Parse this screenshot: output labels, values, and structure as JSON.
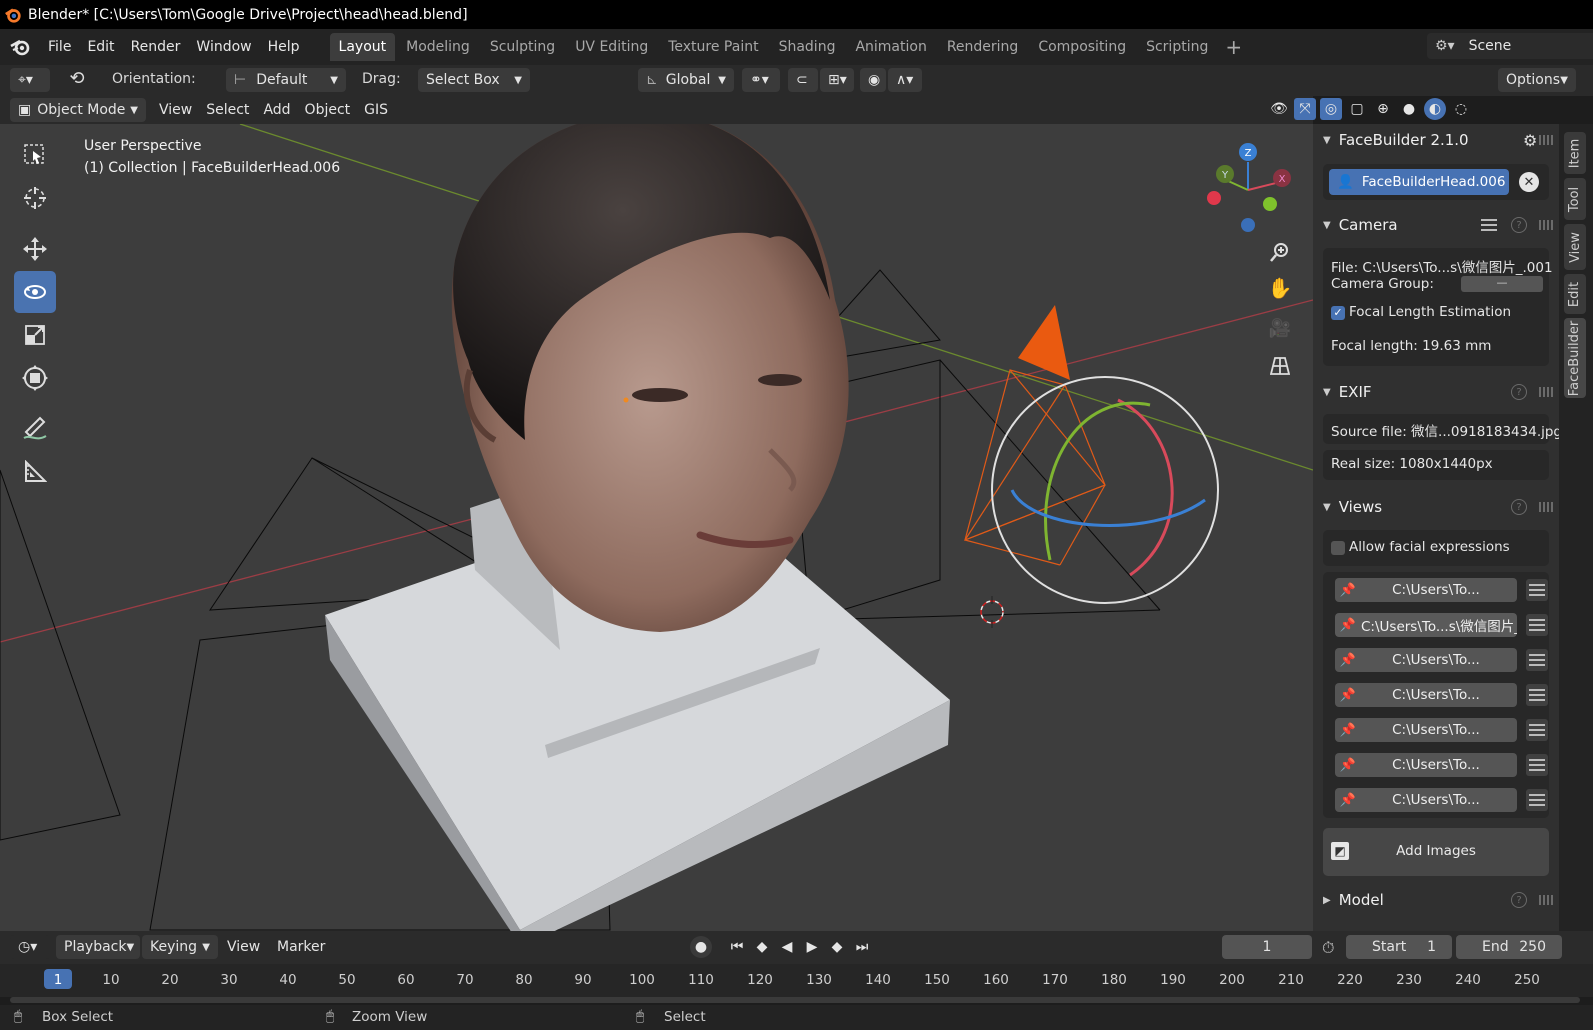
{
  "window": {
    "title": "Blender* [C:\\Users\\Tom\\Google Drive\\Project\\head\\head.blend]"
  },
  "menu": [
    "File",
    "Edit",
    "Render",
    "Window",
    "Help"
  ],
  "workspaces": [
    "Layout",
    "Modeling",
    "Sculpting",
    "UV Editing",
    "Texture Paint",
    "Shading",
    "Animation",
    "Rendering",
    "Compositing",
    "Scripting"
  ],
  "scene": "Scene",
  "toolheader": {
    "orientation_label": "Orientation:",
    "orientation_value": "Default",
    "drag_label": "Drag:",
    "drag_value": "Select Box",
    "transform_orientation": "Global",
    "options": "Options"
  },
  "modeheader": {
    "mode": "Object Mode",
    "items": [
      "View",
      "Select",
      "Add",
      "Object",
      "GIS"
    ]
  },
  "viewport": {
    "perspective": "User Perspective",
    "collection": "(1) Collection | FaceBuilderHead.006",
    "gizmo_axes": [
      "Z",
      "Y",
      "X"
    ]
  },
  "sidebar": {
    "addon_title": "FaceBuilder 2.1.0",
    "head_name": "FaceBuilderHead.006",
    "camera": {
      "title": "Camera",
      "file": "File: C:\\Users\\To...s\\微信图片_.001",
      "group_label": "Camera Group:",
      "group_value": "—",
      "focal_est_label": "Focal Length Estimation",
      "focal_est_checked": true,
      "focal_length": "Focal length: 19.63 mm"
    },
    "exif": {
      "title": "EXIF",
      "source": "Source file: 微信...0918183434.jpg",
      "real_size": "Real size: 1080x1440px"
    },
    "views": {
      "title": "Views",
      "allow_expr": "Allow facial expressions",
      "allow_expr_checked": false,
      "items": [
        "C:\\Users\\To...",
        "C:\\Users\\To...s\\微信图片_",
        "C:\\Users\\To...",
        "C:\\Users\\To...",
        "C:\\Users\\To...",
        "C:\\Users\\To...",
        "C:\\Users\\To..."
      ],
      "add_images": "Add Images"
    },
    "model": {
      "title": "Model"
    },
    "tabs": [
      "Item",
      "Tool",
      "View",
      "Edit",
      "FaceBuilder"
    ]
  },
  "timeline": {
    "menu": [
      "Playback",
      "Keying",
      "View",
      "Marker"
    ],
    "current_frame": "1",
    "start_label": "Start",
    "start": "1",
    "end_label": "End",
    "end": "250",
    "ticks": [
      "10",
      "20",
      "30",
      "40",
      "50",
      "60",
      "70",
      "80",
      "90",
      "100",
      "110",
      "120",
      "130",
      "140",
      "150",
      "160",
      "170",
      "180",
      "190",
      "200",
      "210",
      "220",
      "230",
      "240",
      "250"
    ],
    "cursor_frame": "1"
  },
  "status": {
    "left": "Box Select",
    "middle": "Zoom View",
    "right": "Select"
  },
  "colors": {
    "accent": "#4772b3",
    "bg": "#3d3d3d",
    "x_axis": "#d84a5b",
    "y_axis": "#7fb531",
    "z_axis": "#3a80d4",
    "camera_orange": "#ea5a10"
  }
}
